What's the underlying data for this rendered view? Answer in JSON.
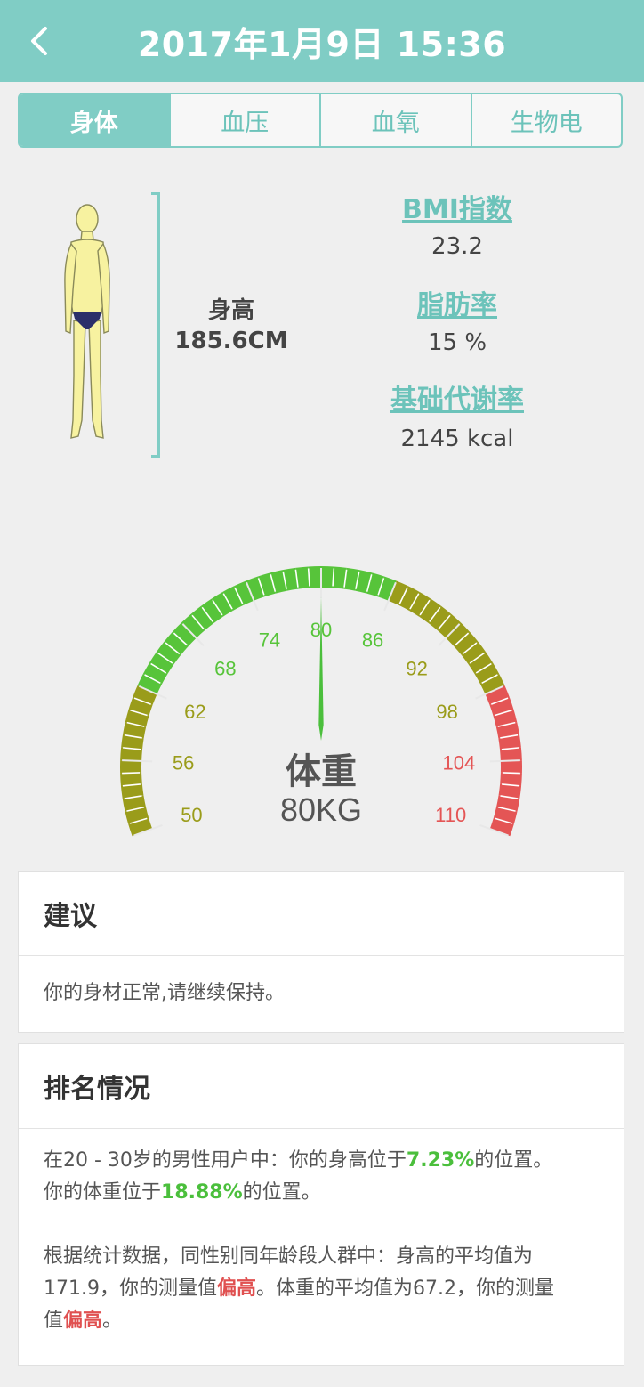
{
  "header": {
    "title": "2017年1月9日 15:36"
  },
  "tabs": [
    {
      "label": "身体",
      "active": true
    },
    {
      "label": "血压",
      "active": false
    },
    {
      "label": "血氧",
      "active": false
    },
    {
      "label": "生物电",
      "active": false
    }
  ],
  "body": {
    "height_label": "身高",
    "height_value": "185.6CM"
  },
  "metrics": {
    "bmi_title": "BMI指数",
    "bmi_value": "23.2",
    "fat_title": "脂肪率",
    "fat_value": "15 %",
    "bmr_title": "基础代谢率",
    "bmr_value": "2145 kcal"
  },
  "gauge": {
    "ticks": [
      "50",
      "56",
      "62",
      "68",
      "74",
      "80",
      "86",
      "92",
      "98",
      "104",
      "110"
    ],
    "min": 50,
    "max": 110,
    "value": 80,
    "label": "体重",
    "value_text": "80KG",
    "colors": {
      "low": "#9a9c1a",
      "normal": "#57c43a",
      "high": "#e45555",
      "needle": "#4bbf3c"
    },
    "zones": [
      {
        "from": 50,
        "to": 62,
        "color": "#9a9c1a"
      },
      {
        "from": 62,
        "to": 86,
        "color": "#57c43a"
      },
      {
        "from": 86,
        "to": 98,
        "color": "#9a9c1a"
      },
      {
        "from": 98,
        "to": 110,
        "color": "#e45555"
      }
    ]
  },
  "advice": {
    "title": "建议",
    "text": "你的身材正常,请继续保持。"
  },
  "ranking": {
    "title": "排名情况",
    "l1_pre": "在20 - 30岁的男性用户中：你的身高位于",
    "l1_pct": "7.23%",
    "l1_post": "的位置。",
    "l2_pre": "你的体重位于",
    "l2_pct": "18.88%",
    "l2_post": "的位置。",
    "p2_a": "根据统计数据，同性别同年龄段人群中：身高的平均值为",
    "p2_b": "171.9，你的测量值",
    "p2_high1": "偏高",
    "p2_c": "。体重的平均值为67.2，你的测量",
    "p2_d": "值",
    "p2_high2": "偏高",
    "p2_e": "。"
  }
}
